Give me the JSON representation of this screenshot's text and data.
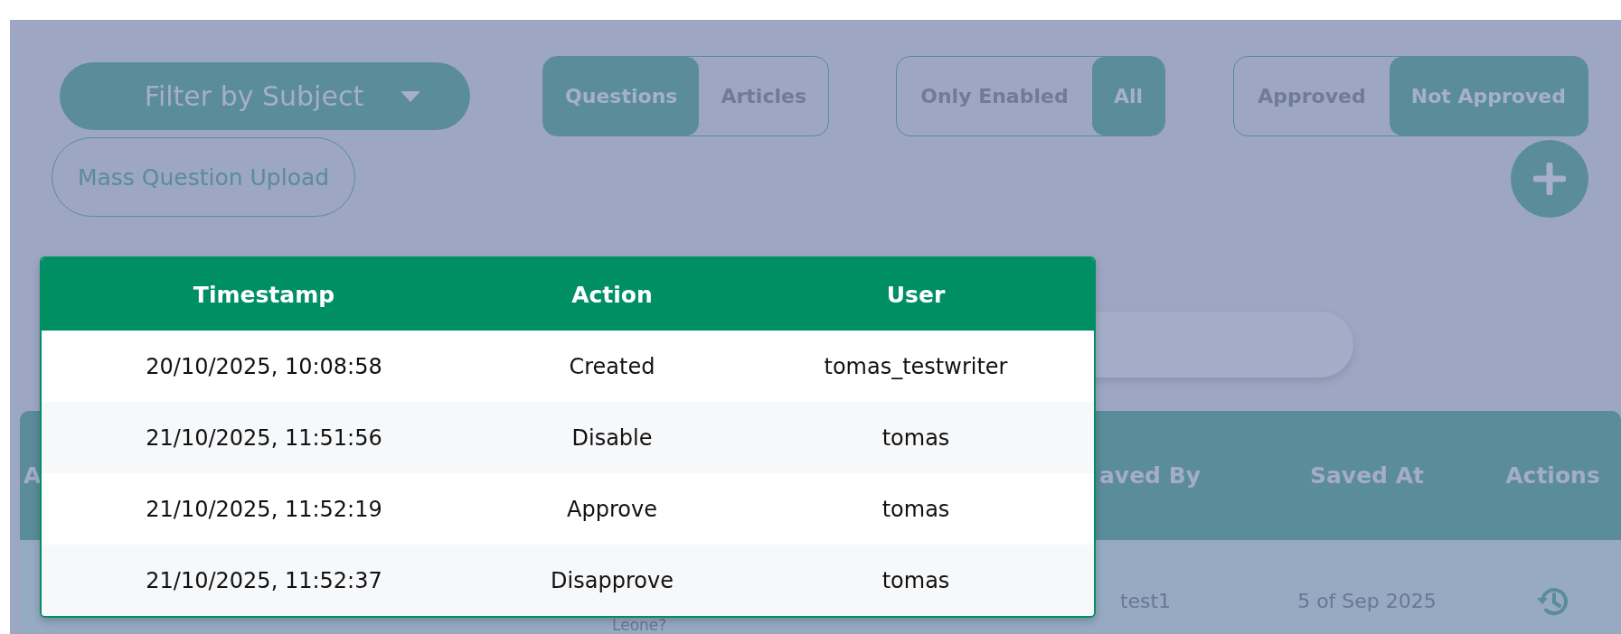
{
  "toolbar": {
    "subject_filter": {
      "label": "Filter by Subject"
    },
    "toggles": [
      {
        "options": [
          {
            "label": "Questions",
            "selected": true
          },
          {
            "label": "Articles",
            "selected": false
          }
        ]
      },
      {
        "options": [
          {
            "label": "Only Enabled",
            "selected": false
          },
          {
            "label": "All",
            "selected": true
          }
        ]
      },
      {
        "options": [
          {
            "label": "Approved",
            "selected": false
          },
          {
            "label": "Not Approved",
            "selected": true
          }
        ]
      }
    ],
    "mass_upload_button": "Mass Question Upload"
  },
  "table": {
    "columns": [
      "A",
      "aved By",
      "Saved At",
      "Actions"
    ],
    "rows": [
      {
        "cells": [
          "Leone?",
          "test1",
          "5 of Sep 2025"
        ]
      }
    ]
  },
  "history_popup": {
    "columns": [
      "Timestamp",
      "Action",
      "User"
    ],
    "rows": [
      [
        "20/10/2025, 10:08:58",
        "Created",
        "tomas_testwriter"
      ],
      [
        "21/10/2025, 11:51:56",
        "Disable",
        "tomas"
      ],
      [
        "21/10/2025, 11:52:19",
        "Approve",
        "tomas"
      ],
      [
        "21/10/2025, 11:52:37",
        "Disapprove",
        "tomas"
      ]
    ]
  }
}
